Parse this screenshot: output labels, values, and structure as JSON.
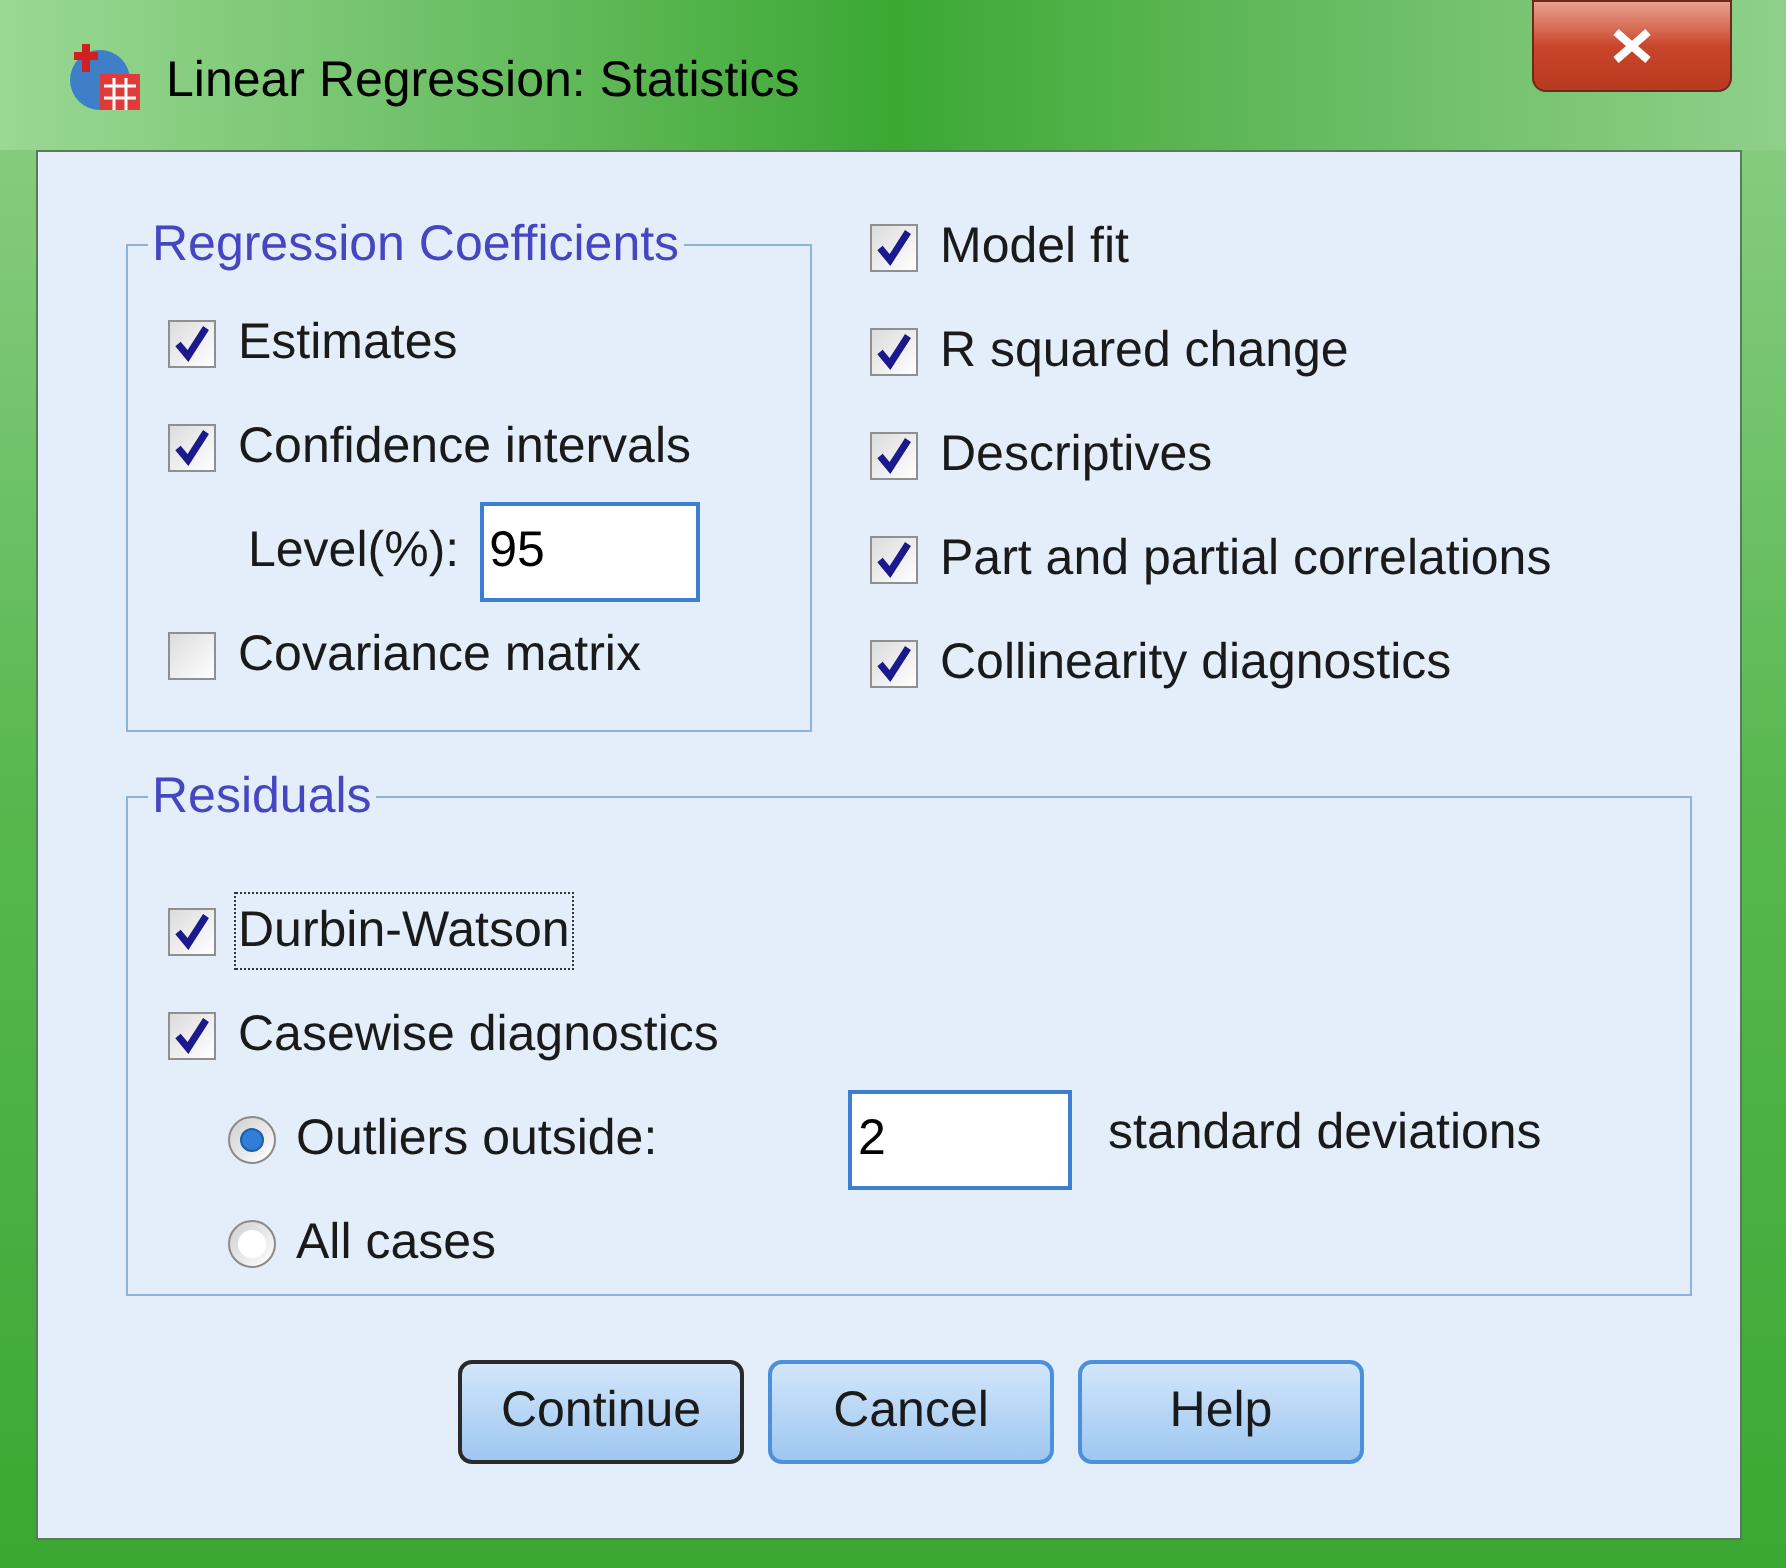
{
  "window": {
    "title": "Linear Regression: Statistics"
  },
  "regression_coefficients": {
    "title": "Regression Coefficients",
    "options": [
      {
        "kind": "checkbox",
        "label": "Estimates",
        "checked": true
      },
      {
        "kind": "checkbox",
        "label": "Confidence intervals",
        "checked": true
      },
      {
        "kind": "field",
        "label": "Level(%):",
        "value": "95"
      },
      {
        "kind": "checkbox",
        "label": "Covariance matrix",
        "checked": false
      }
    ]
  },
  "model_options": [
    {
      "kind": "checkbox",
      "label": "Model fit",
      "checked": true
    },
    {
      "kind": "checkbox",
      "label": "R squared change",
      "checked": true
    },
    {
      "kind": "checkbox",
      "label": "Descriptives",
      "checked": true
    },
    {
      "kind": "checkbox",
      "label": "Part and partial correlations",
      "checked": true
    },
    {
      "kind": "checkbox",
      "label": "Collinearity diagnostics",
      "checked": true
    }
  ],
  "residuals": {
    "title": "Residuals",
    "options": [
      {
        "kind": "checkbox",
        "label": "Durbin-Watson",
        "checked": true,
        "focused": true
      },
      {
        "kind": "checkbox",
        "label": "Casewise diagnostics",
        "checked": true,
        "focused": false
      },
      {
        "kind": "radio",
        "label": "Outliers outside:",
        "selected": true,
        "value": "2",
        "suffix": "standard deviations"
      },
      {
        "kind": "radio",
        "label": "All cases",
        "selected": false
      }
    ]
  },
  "buttons": [
    {
      "label": "Continue",
      "default": true
    },
    {
      "label": "Cancel",
      "default": false
    },
    {
      "label": "Help",
      "default": false
    }
  ]
}
